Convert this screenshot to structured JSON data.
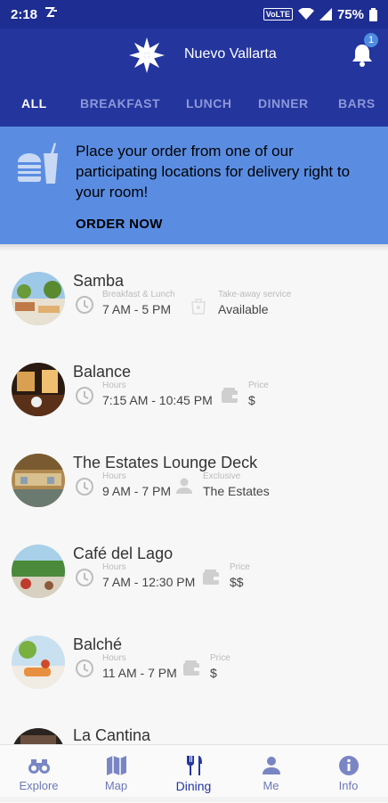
{
  "status": {
    "time": "2:18",
    "volte": "VoLTE",
    "battery": "75%"
  },
  "header": {
    "resort": "Nuevo Vallarta",
    "notifications": "1"
  },
  "tabs": [
    {
      "label": "ALL",
      "active": true
    },
    {
      "label": "BREAKFAST",
      "active": false
    },
    {
      "label": "LUNCH",
      "active": false
    },
    {
      "label": "DINNER",
      "active": false
    },
    {
      "label": "BARS",
      "active": false
    }
  ],
  "promo": {
    "text": "Place your order from one of our participating locations for delivery right to your room!",
    "cta": "ORDER NOW"
  },
  "restaurants": [
    {
      "name": "Samba",
      "hours_label": "Breakfast & Lunch",
      "hours": "7 AM - 5 PM",
      "extra_label": "Take-away service",
      "extra": "Available",
      "extra_icon": "takeaway-icon"
    },
    {
      "name": "Balance",
      "hours_label": "Hours",
      "hours": "7:15 AM - 10:45 PM",
      "extra_label": "Price",
      "extra": "$",
      "extra_icon": "wallet-icon"
    },
    {
      "name": "The Estates Lounge Deck",
      "hours_label": "Hours",
      "hours": "9 AM - 7 PM",
      "extra_label": "Exclusive",
      "extra": "The Estates",
      "extra_icon": "person-icon"
    },
    {
      "name": "Café del Lago",
      "hours_label": "Hours",
      "hours": "7 AM - 12:30 PM",
      "extra_label": "Price",
      "extra": "$$",
      "extra_icon": "wallet-icon"
    },
    {
      "name": "Balché",
      "hours_label": "Hours",
      "hours": "11 AM - 7 PM",
      "extra_label": "Price",
      "extra": "$",
      "extra_icon": "wallet-icon"
    },
    {
      "name": "La Cantina"
    }
  ],
  "nav": [
    {
      "label": "Explore",
      "icon": "binoculars-icon"
    },
    {
      "label": "Map",
      "icon": "map-icon"
    },
    {
      "label": "Dining",
      "icon": "dining-icon",
      "active": true
    },
    {
      "label": "Me",
      "icon": "person-icon"
    },
    {
      "label": "Info",
      "icon": "info-icon"
    }
  ],
  "colors": {
    "header": "#24359e",
    "promo": "#5a8de2",
    "active_tab": "#ffffff",
    "inactive_tab": "#8d98d8"
  }
}
